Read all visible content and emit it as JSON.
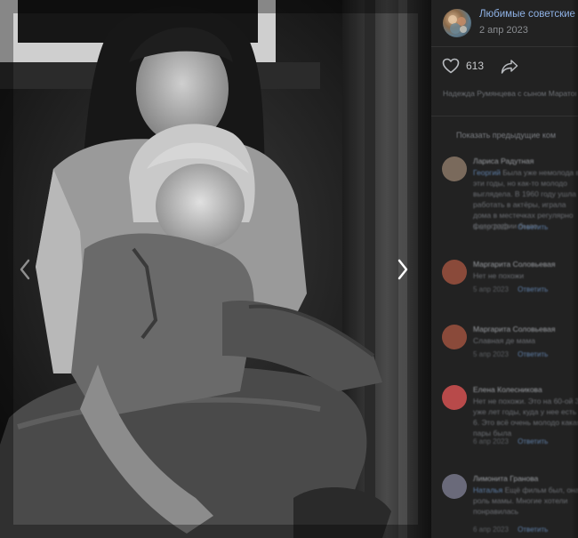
{
  "post": {
    "group_name": "Любимые советские ф",
    "date": "2 апр 2023",
    "likes": "613",
    "caption": "Надежда Румянцева с сыном Маратом"
  },
  "icons": {
    "like": "heart-icon",
    "share": "share-arrow-icon",
    "prev": "chevron-left-icon",
    "next": "chevron-right-icon"
  },
  "comments_section": {
    "show_previous": "Показать предыдущие ком"
  },
  "comments": [
    {
      "author": "Лариса Радутная",
      "text_link": "Георгий",
      "text": "Была уже немолода в эти годы, но как-то молодо выглядела. В 1960 году ушла работать в актёры, играла дома в местечках регулярно фотографии было",
      "date": "5 апр 2023",
      "reply": "Ответить",
      "avatar_color": "#7a6a5c"
    },
    {
      "author": "Маргарита Соловьевая",
      "text_link": "",
      "text": "Нет не похожи",
      "date": "5 апр 2023",
      "reply": "Ответить",
      "avatar_color": "#8a4a3a"
    },
    {
      "author": "Маргарита Соловьевая",
      "text_link": "",
      "text": "Славная де мама",
      "date": "5 апр 2023",
      "reply": "Ответить",
      "avatar_color": "#8a4a3a"
    },
    {
      "author": "Елена Колесникова",
      "text_link": "",
      "text": "Нет не похожи. Это на 60-ой 3 уже лет годы, куда у нее есть 6. Это всё очень молодо какая пары была",
      "date": "6 апр 2023",
      "reply": "Ответить",
      "avatar_color": "#b84a4a"
    },
    {
      "author": "Лимонита Гранова",
      "text_link": "Наталья",
      "text": "Ещё фильм был, она роль мамы. Многие хотели понравилась",
      "date": "6 апр 2023",
      "reply": "Ответить",
      "avatar_color": "#6a6a7a"
    }
  ]
}
